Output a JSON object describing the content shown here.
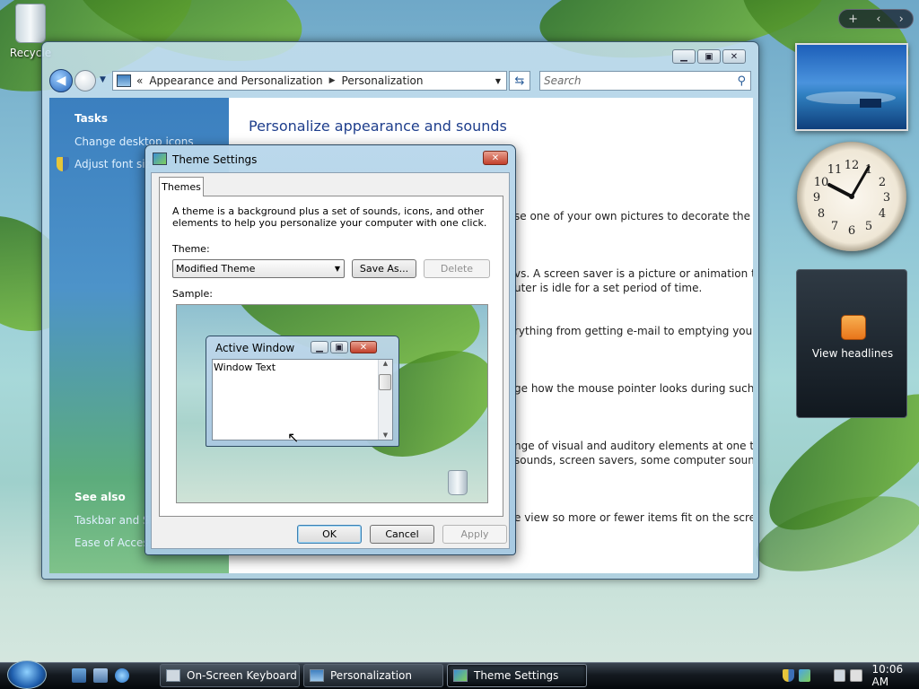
{
  "desktop": {
    "recycle_bin_label": "Recycle"
  },
  "control_panel": {
    "breadcrumb": [
      "Appearance and Personalization",
      "Personalization"
    ],
    "breadcrumb_prefix": "«",
    "search_placeholder": "Search",
    "tasks_heading": "Tasks",
    "tasks": [
      "Change desktop icons",
      "Adjust font size"
    ],
    "see_also_heading": "See also",
    "see_also": [
      "Taskbar and Sta",
      "Ease of Access"
    ],
    "title": "Personalize appearance and sounds",
    "descriptions": [
      "se one of your own pictures to decorate the",
      "vs. A screen saver is a picture or animation that",
      "uter is idle for a set period of time.",
      "rything from getting e-mail to emptying your",
      "ge how the mouse pointer looks during such",
      "nge of visual and auditory elements at one time",
      "sounds, screen savers, some computer sounds,",
      "e view so more or fewer items fit on the screen."
    ]
  },
  "dialog": {
    "title": "Theme Settings",
    "tab": "Themes",
    "description_line1": "A theme is a background plus a set of sounds, icons, and other",
    "description_line2": "elements to help you personalize your computer with one click.",
    "theme_label": "Theme:",
    "theme_value": "Modified Theme",
    "save_as": "Save As...",
    "delete": "Delete",
    "sample_label": "Sample:",
    "sample_window_title": "Active Window",
    "sample_window_text": "Window Text",
    "ok": "OK",
    "cancel": "Cancel",
    "apply": "Apply"
  },
  "sidebar": {
    "controls": [
      "+",
      "‹",
      "›"
    ],
    "feed_label": "View headlines",
    "clock_numbers": [
      "12",
      "1",
      "2",
      "3",
      "4",
      "5",
      "6",
      "7",
      "8",
      "9",
      "10",
      "11"
    ]
  },
  "taskbar": {
    "tasks": [
      "On-Screen Keyboard",
      "Personalization",
      "Theme Settings"
    ],
    "active_task": "Theme Settings",
    "clock": "10:06 AM"
  }
}
